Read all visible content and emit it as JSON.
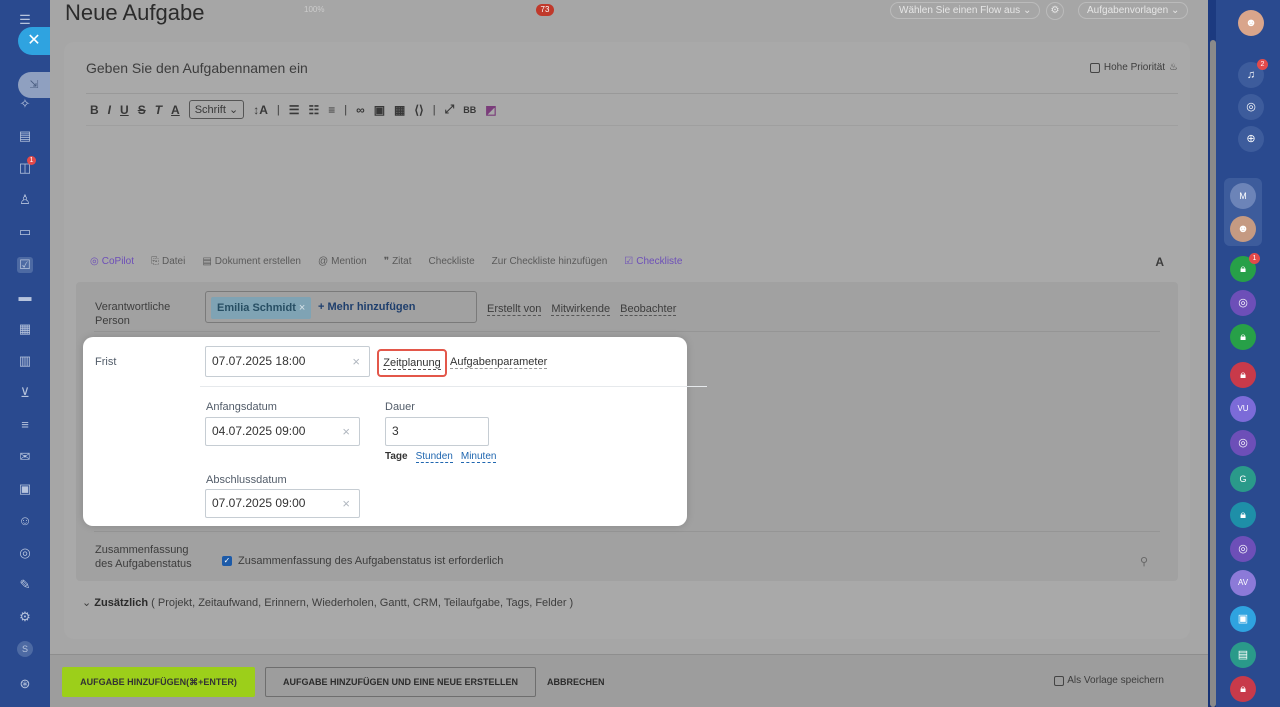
{
  "page_title": "Neue Aufgabe",
  "top_bar": {
    "zoom": "100%",
    "badge": "73",
    "flow_select": "Wählen Sie einen Flow aus",
    "templates": "Aufgabenvorlagen"
  },
  "task": {
    "name_placeholder": "Geben Sie den Aufgabennamen ein",
    "high_priority_label": "Hohe Priorität"
  },
  "toolbar": {
    "font_label": "Schrift",
    "bb_label": "BB"
  },
  "attach_bar": {
    "copilot": "CoPilot",
    "file": "Datei",
    "create_doc": "Dokument erstellen",
    "mention": "Mention",
    "quote": "Zitat",
    "checklist": "Checkliste",
    "add_to_checklist": "Zur Checkliste hinzufügen",
    "checklist2": "Checkliste",
    "text_format": "A"
  },
  "responsible": {
    "label": "Verantwortliche Person",
    "assignee": "Emilia Schmidt",
    "add_more": "+ Mehr hinzufügen",
    "created_by": "Erstellt von",
    "participants": "Mitwirkende",
    "observers": "Beobachter"
  },
  "deadline": {
    "label": "Frist",
    "value": "07.07.2025 18:00",
    "time_planning": "Zeitplanung",
    "task_params": "Aufgabenparameter",
    "start_label": "Anfangsdatum",
    "start_value": "04.07.2025 09:00",
    "duration_label": "Dauer",
    "duration_value": "3",
    "unit_days": "Tage",
    "unit_hours": "Stunden",
    "unit_minutes": "Minuten",
    "end_label": "Abschlussdatum",
    "end_value": "07.07.2025 09:00"
  },
  "summary": {
    "label": "Zusammenfassung des Aufgabenstatus",
    "checkbox_text": "Zusammenfassung des Aufgabenstatus ist erforderlich"
  },
  "additional": {
    "label": "Zusätzlich",
    "items": "( Projekt,  Zeitaufwand,  Erinnern,  Wiederholen,  Gantt,  CRM,  Teilaufgabe,  Tags,  Felder )"
  },
  "footer": {
    "add_task": "AUFGABE HINZUFÜGEN(⌘+ENTER)",
    "add_and_new": "AUFGABE HINZUFÜGEN UND EINE NEUE ERSTELLEN",
    "cancel": "ABBRECHEN",
    "save_template": "Als Vorlage speichern"
  },
  "right_rail": {
    "notif_badge": "2",
    "item_badge": "1",
    "avatar_initials_1": "M",
    "avatar_initials_2": "VU",
    "avatar_initials_3": "G",
    "avatar_initials_4": "AV"
  },
  "left_rail": {
    "chat_badge": "1",
    "user_initial": "S"
  },
  "colors": {
    "accent_green": "#9ccf1a",
    "highlight_red": "#e3574a",
    "link_blue": "#2067b0",
    "close_blue": "#2fa3e0"
  }
}
